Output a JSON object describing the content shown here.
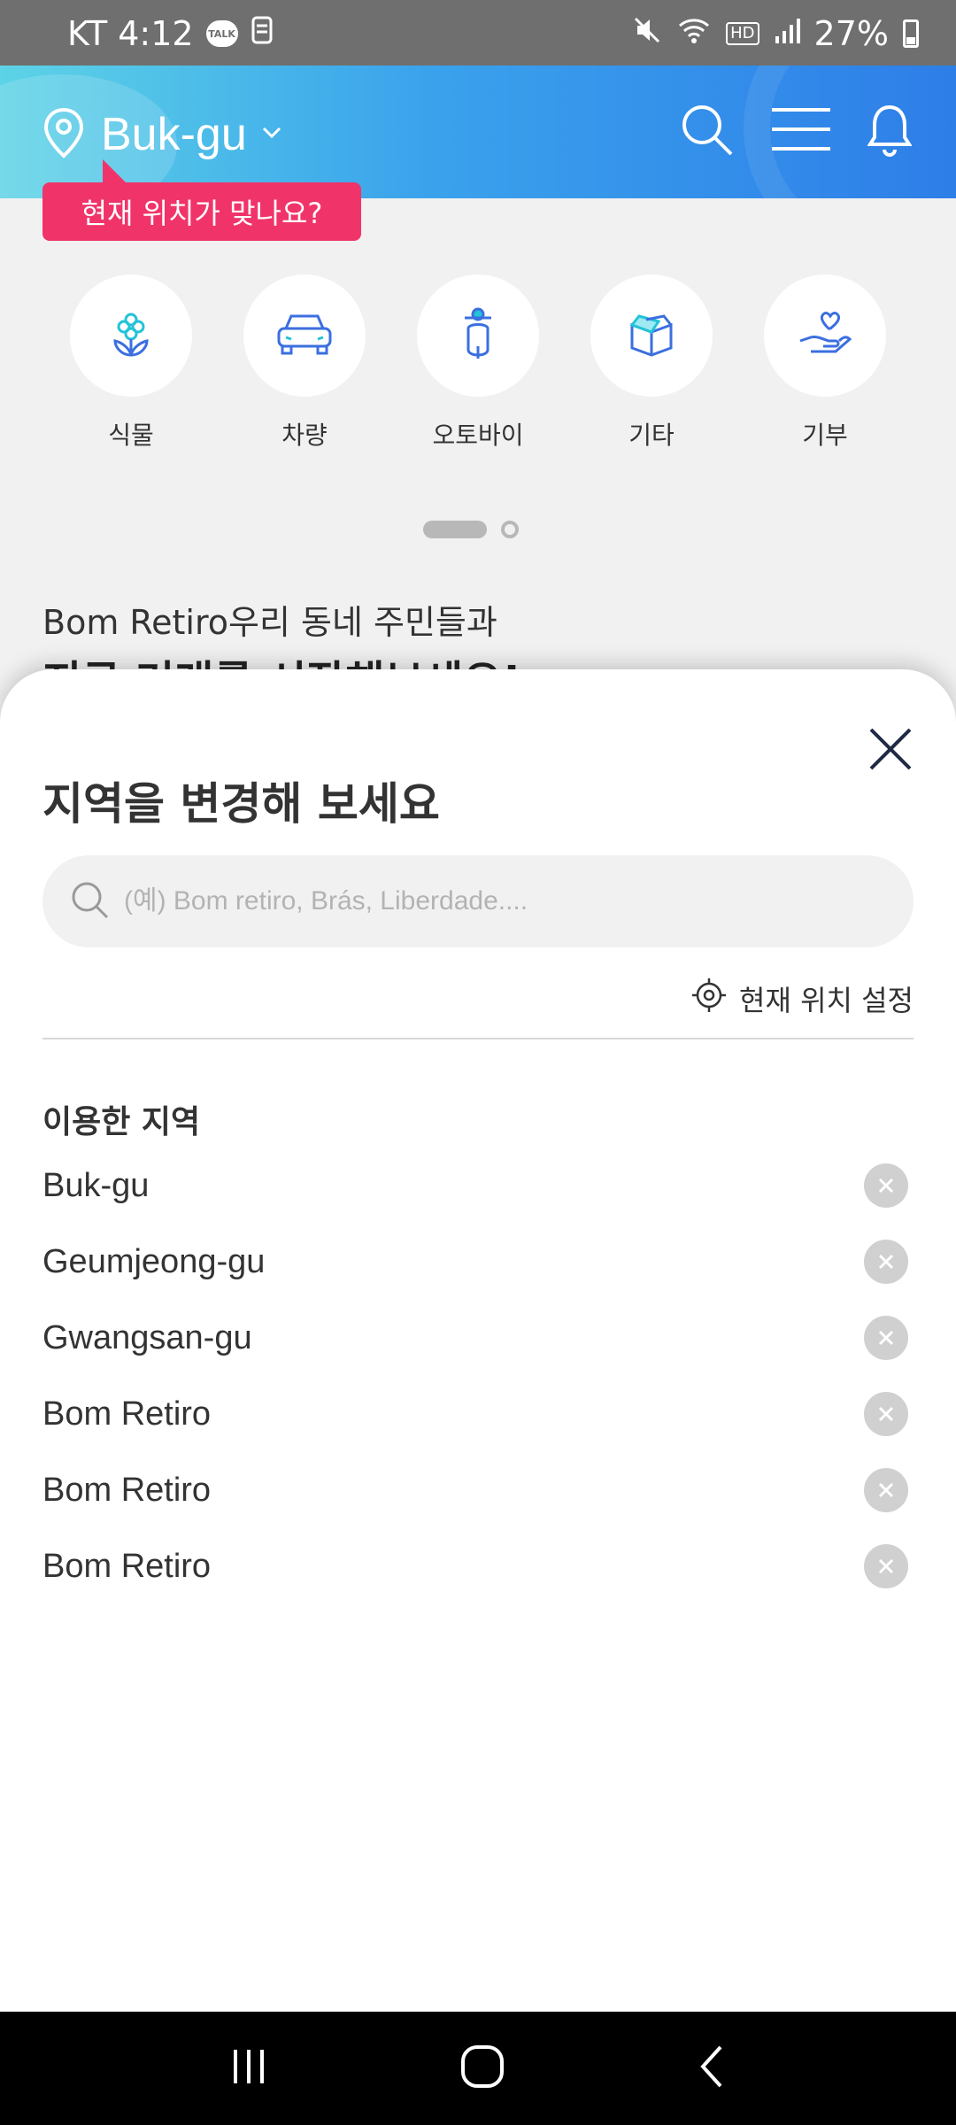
{
  "status_bar": {
    "carrier_time": "KT 4:12",
    "talk_badge": "TALK",
    "hd": "HD",
    "battery": "27%"
  },
  "header": {
    "location": "Buk-gu"
  },
  "tooltip": "현재 위치가 맞나요?",
  "categories": [
    {
      "label": "식물",
      "icon": "plant-icon"
    },
    {
      "label": "차량",
      "icon": "car-icon"
    },
    {
      "label": "오토바이",
      "icon": "scooter-icon"
    },
    {
      "label": "기타",
      "icon": "box-icon"
    },
    {
      "label": "기부",
      "icon": "donation-icon"
    }
  ],
  "pager": {
    "current": 1,
    "total": 2
  },
  "promo": {
    "subtitle": "Bom Retiro우리 동네 주민들과",
    "title": "지금 거래를 시작해보세요!"
  },
  "sheet": {
    "title": "지역을 변경해 보세요",
    "search_placeholder": "(예) Bom retiro, Brás, Liberdade....",
    "current_location_label": "현재 위치 설정",
    "recent_heading": "이용한 지역",
    "recent_locations": [
      "Buk-gu",
      "Geumjeong-gu",
      "Gwangsan-gu",
      "Bom Retiro",
      "Bom Retiro",
      "Bom Retiro"
    ]
  },
  "colors": {
    "accent": "#2e7ee8",
    "tooltip": "#f0346a",
    "icon_blue": "#3b6fe0",
    "icon_teal": "#23c3d8"
  }
}
